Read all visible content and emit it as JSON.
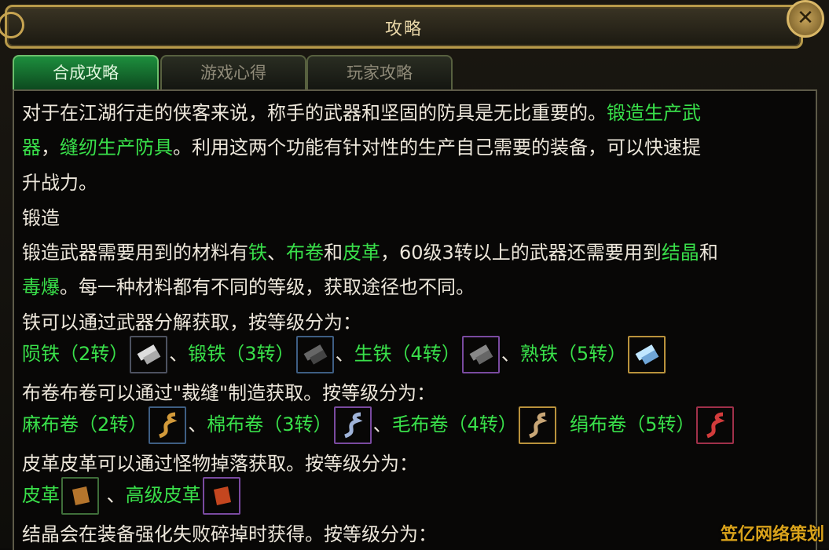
{
  "window": {
    "title": "攻略",
    "close_symbol": "✕"
  },
  "tabs": [
    {
      "label": "合成攻略"
    },
    {
      "label": "游戏心得"
    },
    {
      "label": "玩家攻略"
    }
  ],
  "content": {
    "p1_a": "对于在江湖行走的侠客来说，称手的武器和坚固的防具是无比重要的。",
    "p1_b": "锻造生产武",
    "p2_a": "器",
    "p2_b": "，",
    "p2_c": "缝纫生产防具",
    "p2_d": "。利用这两个功能有针对性的生产自己需要的装备，可以快速提",
    "p3": "升战力。",
    "p4": "锻造",
    "p5_a": "锻造武器需要用到的材料有",
    "p5_b": "铁",
    "p5_c": "、",
    "p5_d": "布卷",
    "p5_e": "和",
    "p5_f": "皮革",
    "p5_g": "，60级3转以上的武器还需要用到",
    "p5_h": "结晶",
    "p5_i": "和",
    "p6_a": "毒爆",
    "p6_b": "。每一种材料都有不同的等级，获取途径也不同。",
    "p7": "铁可以通过武器分解获取，按等级分为：",
    "iron": [
      {
        "name": "陨铁（2转）"
      },
      {
        "name": "锻铁（3转）"
      },
      {
        "name": "生铁（4转）"
      },
      {
        "name": "熟铁（5转）"
      }
    ],
    "sep": "、",
    "p9": "布卷布卷可以通过\"裁缝\"制造获取。按等级分为：",
    "cloth": [
      {
        "name": "麻布卷（2转）"
      },
      {
        "name": "棉布卷（3转）"
      },
      {
        "name": "毛布卷（4转）"
      },
      {
        "name": "绢布卷（5转）"
      }
    ],
    "p11": "皮革皮革可以通过怪物掉落获取。按等级分为：",
    "leather": [
      {
        "name": "皮革"
      },
      {
        "name": "高级皮革"
      }
    ],
    "p13": "结晶会在装备强化失败碎掉时获得。按等级分为："
  },
  "watermark": "笠亿网络策划",
  "colors": {
    "highlight": "#39e04a",
    "text": "#ece6da",
    "tab_active": "#1d8e3d"
  }
}
